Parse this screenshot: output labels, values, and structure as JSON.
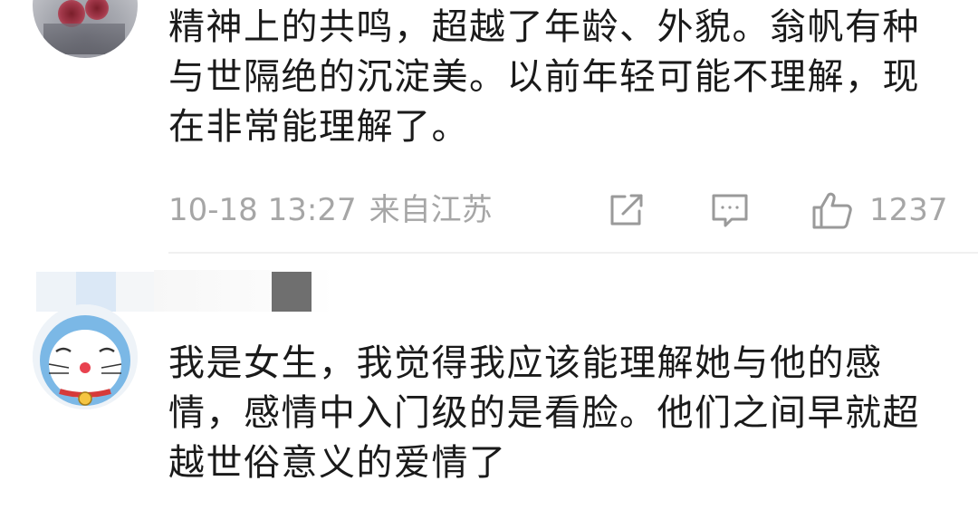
{
  "comments": [
    {
      "text": "精神上的共鸣，超越了年龄、外貌。翁帆有种与世隔绝的沉淀美。以前年轻可能不理解，现在非常能理解了。",
      "date": "10-18 13:27",
      "location": "来自江苏",
      "like_count": "1237",
      "icons": [
        "share-icon",
        "comment-icon",
        "thumbs-up-icon"
      ]
    },
    {
      "text": "我是女生，我觉得我应该能理解她与他的感情，感情中入门级的是看脸。他们之间早就超越世俗意义的爱情了"
    }
  ],
  "colors": {
    "text": "#1a1a1a",
    "meta": "#a6a6a6",
    "icon": "#9a9a9a",
    "divider": "#f0f0f0"
  }
}
